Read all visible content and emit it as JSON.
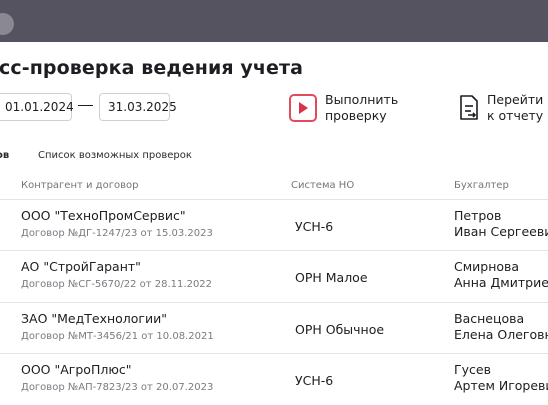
{
  "header": {
    "title": "есс-проверка ведения учета"
  },
  "period": {
    "from": "01.01.2024",
    "to": "31.03.2025"
  },
  "actions": {
    "check_line1": "Выполнить",
    "check_line2": "проверку",
    "report_line1": "Перейти",
    "report_line2": "к отчету"
  },
  "tabs": [
    "ов",
    "Список возможных проверок"
  ],
  "table": {
    "columns": [
      "Контрагент и договор",
      "Система НО",
      "Бухгалтер"
    ],
    "rows": [
      {
        "name": "ООО \"ТехноПромСервис\"",
        "contract": "Договор №ДГ-1247/23 от 15.03.2023",
        "system": "УСН-6",
        "accountant_last": "Петров",
        "accountant_first": "Иван Сергеевич"
      },
      {
        "name": "АО \"СтройГарант\"",
        "contract": "Договор №СГ-5670/22 от 28.11.2022",
        "system": "ОРН Малое",
        "accountant_last": "Смирнова",
        "accountant_first": "Анна Дмитриевна"
      },
      {
        "name": "ЗАО \"МедТехнологии\"",
        "contract": "Договор №МТ-3456/21 от 10.08.2021",
        "system": "ОРН Обычное",
        "accountant_last": "Васнецова",
        "accountant_first": "Елена Олеговна"
      },
      {
        "name": "ООО \"АгроПлюс\"",
        "contract": "Договор №АП-7823/23 от 20.07.2023",
        "system": "УСН-6",
        "accountant_last": "Гусев",
        "accountant_first": "Артем Игоревич"
      }
    ]
  },
  "colors": {
    "topbar": "#55535f",
    "accent": "#e24b5c"
  },
  "icons": {
    "check": "play-icon",
    "report": "document-arrow-icon"
  }
}
